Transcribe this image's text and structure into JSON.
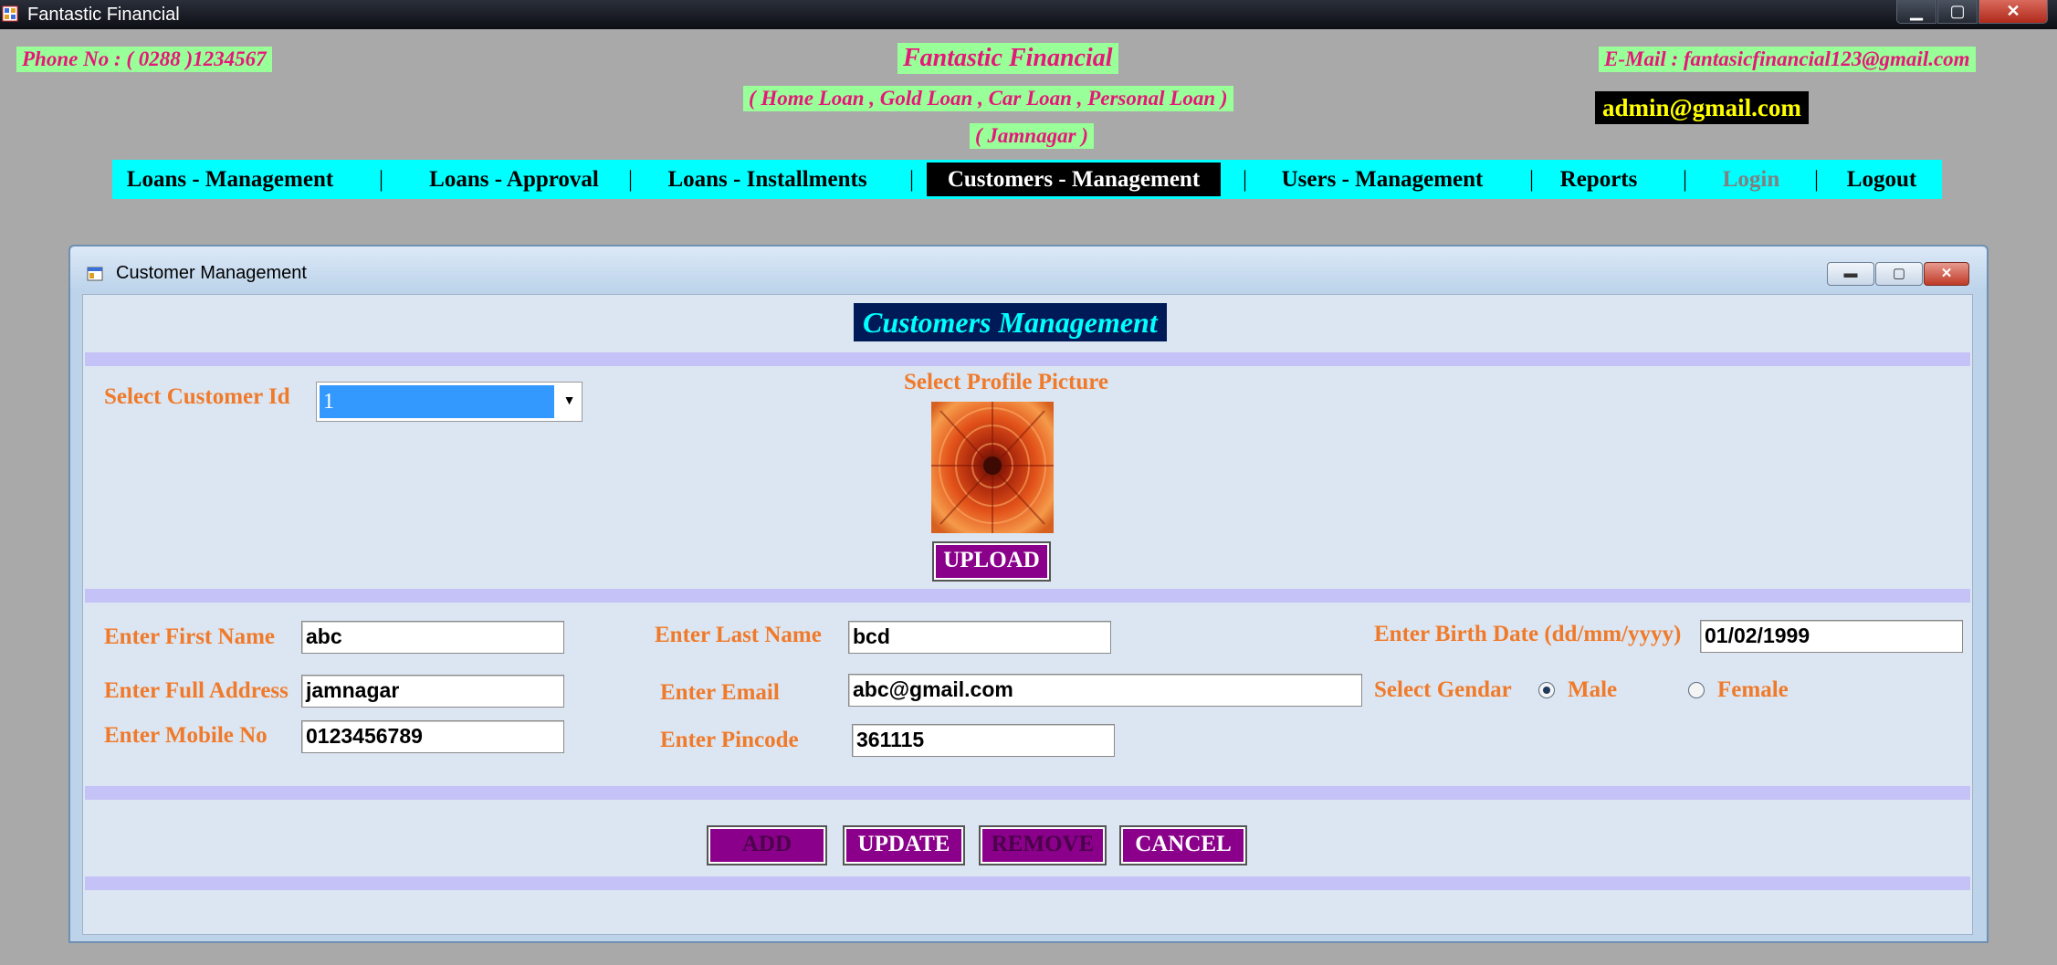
{
  "window": {
    "title": "Fantastic Financial",
    "controls": {
      "minimize": "▁",
      "maximize": "▢",
      "close": "✕"
    }
  },
  "header": {
    "phone": "Phone No : ( 0288 )1234567",
    "app_name": "Fantastic Financial",
    "loans": "( Home Loan , Gold Loan , Car Loan , Personal Loan )",
    "city": "( Jamnagar )",
    "email": "E-Mail : fantasicfinancial123@gmail.com",
    "user": "admin@gmail.com"
  },
  "menu": {
    "items": [
      {
        "label": "Loans - Management",
        "state": "normal"
      },
      {
        "label": "Loans - Approval",
        "state": "normal"
      },
      {
        "label": "Loans - Installments",
        "state": "normal"
      },
      {
        "label": "Customers - Management",
        "state": "active"
      },
      {
        "label": "Users - Management",
        "state": "normal"
      },
      {
        "label": "Reports",
        "state": "normal"
      },
      {
        "label": "Login",
        "state": "disabled"
      },
      {
        "label": "Logout",
        "state": "normal"
      }
    ],
    "separator": "|"
  },
  "child_window": {
    "title": "Customer Management",
    "controls": {
      "minimize": "▬",
      "maximize": "▢",
      "close": "✕"
    }
  },
  "form": {
    "heading": "Customers Management",
    "select_customer_label": "Select Customer Id",
    "customer_id": "1",
    "profile_label": "Select Profile Picture",
    "upload": "UPLOAD",
    "first_name_label": "Enter First Name",
    "first_name": "abc",
    "last_name_label": "Enter Last Name",
    "last_name": "bcd",
    "birth_date_label": "Enter Birth Date (dd/mm/yyyy)",
    "birth_date": "01/02/1999",
    "address_label": "Enter Full Address",
    "address": "jamnagar",
    "email_label": "Enter Email",
    "email": "abc@gmail.com",
    "gender_label": "Select Gendar",
    "gender_options": [
      "Male",
      "Female"
    ],
    "gender_selected": "Male",
    "mobile_label": "Enter Mobile No",
    "mobile": "0123456789",
    "pincode_label": "Enter Pincode",
    "pincode": "361115"
  },
  "actions": {
    "add": {
      "label": "ADD",
      "enabled": false
    },
    "update": {
      "label": "UPDATE",
      "enabled": true
    },
    "remove": {
      "label": "REMOVE",
      "enabled": false
    },
    "cancel": {
      "label": "CANCEL",
      "enabled": true
    }
  },
  "colors": {
    "header_bg": "#99ff99",
    "header_text": "#e6177a",
    "menu_bg": "#00ffff",
    "label": "#f07a2a",
    "button": "#8a008a",
    "band": "#c4c2f6",
    "client": "#dbe6f2"
  }
}
